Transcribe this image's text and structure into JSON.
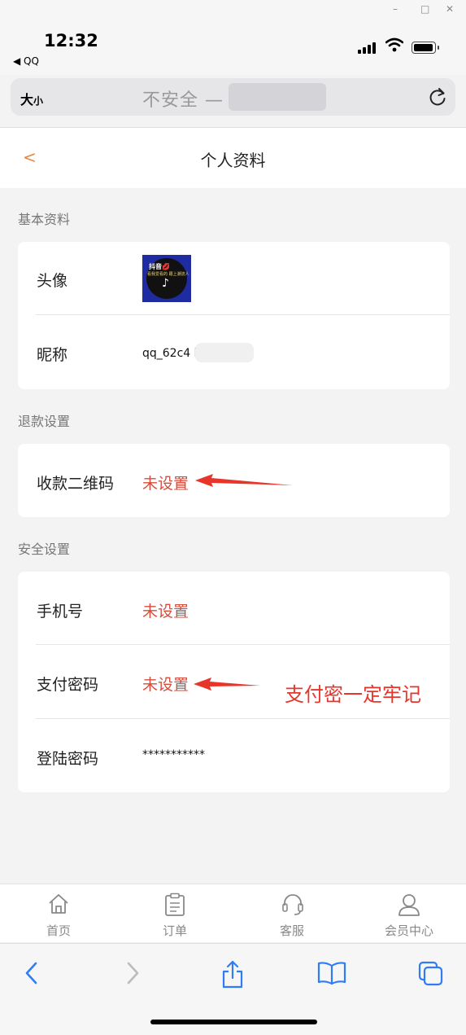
{
  "window_controls": {
    "min": "–",
    "max": "□",
    "close": "✕"
  },
  "status_bar": {
    "time": "12:32",
    "back_app": "◀ QQ"
  },
  "address_bar": {
    "size_label": "大",
    "size_small": "小",
    "url_text": "不安全 — "
  },
  "nav": {
    "back": "<",
    "title": "个人资料"
  },
  "sections": {
    "basic": "基本资料",
    "refund": "退款设置",
    "security": "安全设置"
  },
  "basic": {
    "avatar_label": "头像",
    "avatar_text": {
      "top": "抖音💋",
      "sub": "看我爱看的 跟上潮流人",
      "logo": "♪"
    },
    "nickname_label": "昵称",
    "nickname_value": "qq_62c4          b3"
  },
  "refund": {
    "qrcode_label": "收款二维码",
    "qrcode_value": "未设置"
  },
  "security": {
    "phone_label": "手机号",
    "phone_value": "未设置",
    "paypwd_label": "支付密码",
    "paypwd_value": "未设置",
    "loginpwd_label": "登陆密码",
    "loginpwd_value": "***********"
  },
  "annotation": {
    "text": "支付密一定牢记",
    "color": "#e8352b"
  },
  "tabbar": [
    {
      "label": "首页",
      "icon": "home-icon"
    },
    {
      "label": "订单",
      "icon": "order-icon"
    },
    {
      "label": "客服",
      "icon": "headset-icon"
    },
    {
      "label": "会员中心",
      "icon": "user-icon"
    }
  ],
  "colors": {
    "accent": "#e48a45",
    "unset": "#d84c3c",
    "safari_blue": "#2f7cf6"
  }
}
